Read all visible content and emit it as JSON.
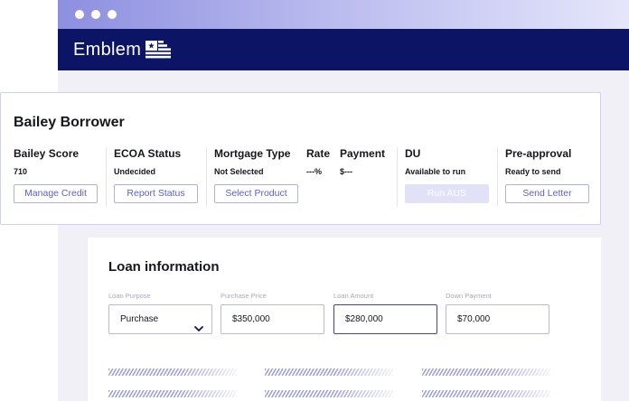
{
  "brand": {
    "name": "Emblem",
    "color_navy": "#0c1466",
    "accent": "#5a5fcf"
  },
  "borrower": {
    "name": "Bailey Borrower",
    "columns": [
      {
        "title": "Bailey Score",
        "value": "710",
        "button": "Manage Credit"
      },
      {
        "title": "ECOA Status",
        "value": "Undecided",
        "button": "Report Status"
      },
      {
        "title": "Mortgage Type",
        "value": "Not Selected",
        "button": "Select Product"
      },
      {
        "title": "Rate",
        "value": "---%"
      },
      {
        "title": "Payment",
        "value": "$---"
      },
      {
        "title": "DU",
        "value": "Available to run",
        "button": "Run AUS",
        "button_disabled": true
      },
      {
        "title": "Pre-approval",
        "value": "Ready to send",
        "button": "Send Letter"
      }
    ]
  },
  "loan": {
    "title": "Loan information",
    "fields": [
      {
        "label": "Loan Purpose",
        "value": "Purchase",
        "type": "select"
      },
      {
        "label": "Purchase Price",
        "value": "$350,000"
      },
      {
        "label": "Loan Amount",
        "value": "$280,000",
        "focused": true
      },
      {
        "label": "Down Payment",
        "value": "$70,000"
      }
    ]
  },
  "icons": [
    "window-dot-icon",
    "emblem-logo-icon",
    "chevron-down-icon"
  ]
}
